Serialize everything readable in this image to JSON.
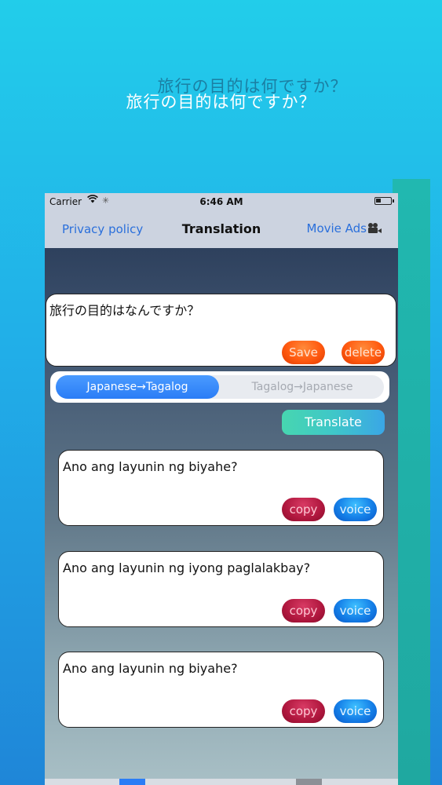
{
  "promo": {
    "headline_shadow": "旅行の目的は何ですか？",
    "headline": "旅行の目的は何ですか？"
  },
  "status_bar": {
    "carrier": "Carrier",
    "wifi_icon": "wifi-icon",
    "activity_icon": "activity-spinner-icon",
    "time": "6:46 AM",
    "battery_icon": "battery-icon"
  },
  "nav": {
    "left": "Privacy policy",
    "title": "Translation",
    "right": "Movie Ads",
    "right_icon": "movie-camera-icon"
  },
  "input": {
    "text": "旅行の目的はなんですか？",
    "save_label": "Save",
    "delete_label": "delete"
  },
  "direction": {
    "options": [
      "Japanese→Tagalog",
      "Tagalog→Japanese"
    ],
    "selected": "Japanese→Tagalog"
  },
  "translate_label": "Translate",
  "results": [
    {
      "text": "Ano ang layunin ng biyahe?",
      "copy_label": "copy",
      "voice_label": "voice"
    },
    {
      "text": "Ano ang layunin ng iyong paglalakbay?",
      "copy_label": "copy",
      "voice_label": "voice"
    },
    {
      "text": "Ano ang layunin ng biyahe?",
      "copy_label": "copy",
      "voice_label": "voice"
    }
  ],
  "colors": {
    "accent_blue": "#2a7df6",
    "orange_button": "#ff5a10",
    "copy_button": "#b0173e",
    "voice_button": "#1580e8",
    "background_top": "#22cdea",
    "teal_slab": "#21b8b0"
  }
}
